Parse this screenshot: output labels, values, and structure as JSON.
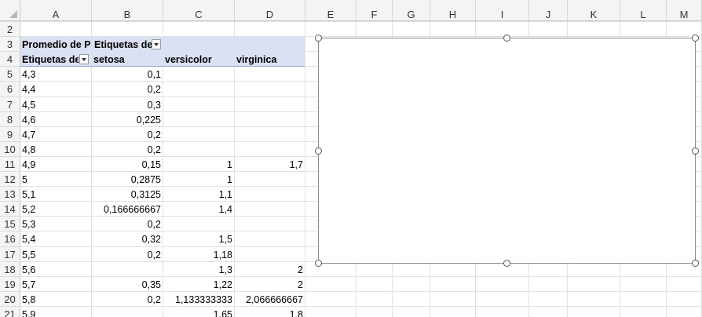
{
  "columns": [
    "A",
    "B",
    "C",
    "D",
    "E",
    "F",
    "G",
    "H",
    "I",
    "J",
    "K",
    "L",
    "M"
  ],
  "rows": [
    "2",
    "3",
    "4",
    "5",
    "6",
    "7",
    "8",
    "9",
    "10",
    "11",
    "12",
    "13",
    "14",
    "15",
    "16",
    "17",
    "18",
    "19",
    "20",
    "21"
  ],
  "pivot": {
    "title": "Promedio de P",
    "col_labels_header": "Etiquetas de",
    "row_labels_header": "Etiquetas de",
    "series_headers": [
      "setosa",
      "versicolor",
      "virginica"
    ],
    "rows": [
      {
        "label": "4,3",
        "setosa": "0,1",
        "versicolor": "",
        "virginica": ""
      },
      {
        "label": "4,4",
        "setosa": "0,2",
        "versicolor": "",
        "virginica": ""
      },
      {
        "label": "4,5",
        "setosa": "0,3",
        "versicolor": "",
        "virginica": ""
      },
      {
        "label": "4,6",
        "setosa": "0,225",
        "versicolor": "",
        "virginica": ""
      },
      {
        "label": "4,7",
        "setosa": "0,2",
        "versicolor": "",
        "virginica": ""
      },
      {
        "label": "4,8",
        "setosa": "0,2",
        "versicolor": "",
        "virginica": ""
      },
      {
        "label": "4,9",
        "setosa": "0,15",
        "versicolor": "1",
        "virginica": "1,7"
      },
      {
        "label": "5",
        "setosa": "0,2875",
        "versicolor": "1",
        "virginica": ""
      },
      {
        "label": "5,1",
        "setosa": "0,3125",
        "versicolor": "1,1",
        "virginica": ""
      },
      {
        "label": "5,2",
        "setosa": "0,166666667",
        "versicolor": "1,4",
        "virginica": ""
      },
      {
        "label": "5,3",
        "setosa": "0,2",
        "versicolor": "",
        "virginica": ""
      },
      {
        "label": "5,4",
        "setosa": "0,32",
        "versicolor": "1,5",
        "virginica": ""
      },
      {
        "label": "5,5",
        "setosa": "0,2",
        "versicolor": "1,18",
        "virginica": ""
      },
      {
        "label": "5,6",
        "setosa": "",
        "versicolor": "1,3",
        "virginica": "2"
      },
      {
        "label": "5,7",
        "setosa": "0,35",
        "versicolor": "1,22",
        "virginica": "2"
      },
      {
        "label": "5,8",
        "setosa": "0,2",
        "versicolor": "1,133333333",
        "virginica": "2,066666667"
      },
      {
        "label": "5,9",
        "setosa": "",
        "versicolor": "1,65",
        "virginica": "1,8"
      }
    ]
  }
}
